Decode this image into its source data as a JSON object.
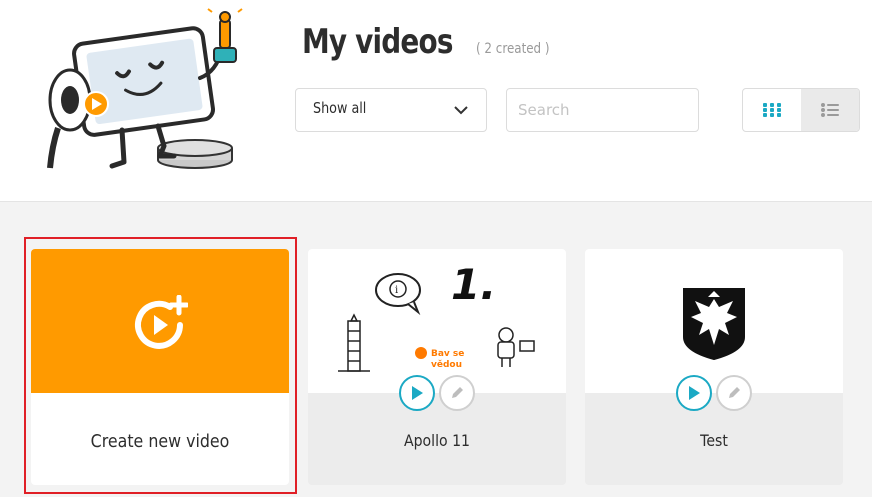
{
  "header": {
    "title": "My videos",
    "count": "( 2 created )"
  },
  "filters": {
    "show_selected": "Show all",
    "search_placeholder": "Search"
  },
  "view_toggle": {
    "grid_icon": "grid-icon",
    "list_icon": "list-icon"
  },
  "create_card": {
    "label": "Create new video",
    "icon": "add-video-icon"
  },
  "videos": [
    {
      "title": "Apollo 11",
      "thumb_text_1": "1.",
      "thumb_text_2": "Bav se",
      "thumb_text_3": "vědou"
    },
    {
      "title": "Test"
    }
  ],
  "colors": {
    "accent_orange": "#ff9a00",
    "play_teal": "#1ba9c4",
    "highlight_red": "#e01f26",
    "title_dark": "#2d2d2d"
  }
}
